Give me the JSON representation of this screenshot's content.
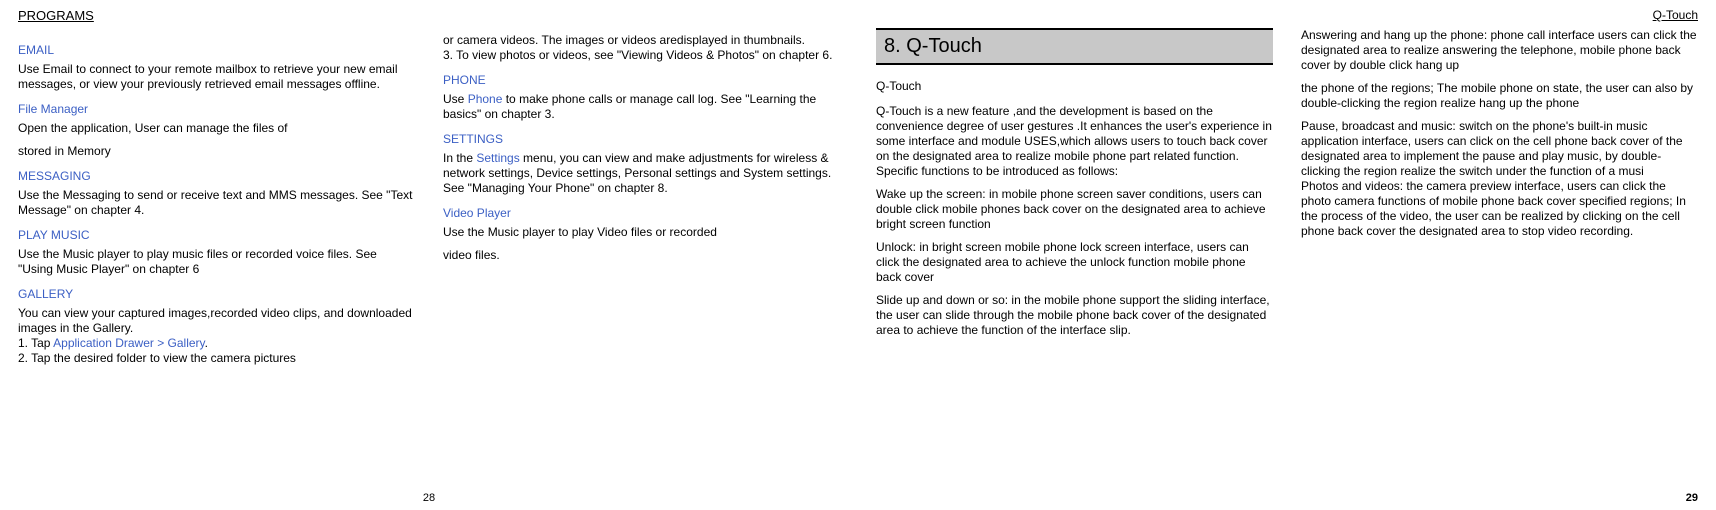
{
  "leftPage": {
    "header": "PROGRAMS",
    "col1": {
      "email_h": "EMAIL",
      "email_p": "Use Email to connect to your remote mailbox to retrieve your new email messages, or view your previously retrieved email messages offline.",
      "fm_h": "File Manager",
      "fm_p1": "Open the application, User can manage the files of",
      "fm_p2": "stored in Memory",
      "msg_h": "MESSAGING",
      "msg_p": "Use the Messaging to send or receive text and MMS messages. See \"Text Message\" on chapter 4.",
      "pm_h": "PLAY MUSIC",
      "pm_p": "Use the Music player to play music files or recorded voice files. See \"Using Music Player\" on chapter 6",
      "gal_h": "GALLERY",
      "gal_p1": "You can view your captured images,recorded video clips, and downloaded images in the Gallery.",
      "gal_p2a": "1. Tap ",
      "gal_p2b": "Application Drawer > Gallery",
      "gal_p2c": ".",
      "gal_p3": "2. Tap the desired folder to view the camera pictures"
    },
    "col2": {
      "cont1": "or camera videos. The images or videos aredisplayed in thumbnails.",
      "cont2": "3. To view photos or videos, see \"Viewing Videos & Photos\" on chapter 6.",
      "phone_h": "PHONE",
      "phone_p_a": "Use ",
      "phone_p_b": "Phone",
      "phone_p_c": " to make phone calls or manage call log. See \"Learning the basics\" on chapter 3.",
      "set_h": "SETTINGS",
      "set_p_a": "In the ",
      "set_p_b": "Settings",
      "set_p_c": " menu, you can view and make adjustments for wireless & network settings, Device settings, Personal settings and System settings. See \"Managing Your Phone\" on chapter 8.",
      "vp_h": "Video Player",
      "vp_p1": "Use the Music player to play Video files or recorded",
      "vp_p2": "video files."
    },
    "pageNum": "28"
  },
  "rightPage": {
    "header": "Q-Touch",
    "col1": {
      "banner": "8. Q-Touch",
      "sub": "Q-Touch",
      "intro": "Q-Touch is a new feature ,and the development is based on the convenience degree of user gestures .It enhances the user's experience in some interface and module USES,which allows users to touch back cover on the designated area to realize mobile phone part related function. Specific functions to be introduced as follows:",
      "wake": "Wake up the screen: in mobile phone screen saver conditions, users can double click mobile phones back cover on the designated area to achieve bright screen function",
      "unlock": "Unlock: in bright screen mobile phone lock screen interface, users can click the designated area to achieve the unlock function mobile phone back cover",
      "slide": "Slide up and down or so: in the mobile phone support the sliding interface, the user can slide through the mobile phone back cover of the designated area to achieve the function of the interface slip."
    },
    "col2": {
      "ans": "Answering and hang up the phone: phone call interface users can click the designated area to realize answering the telephone, mobile phone back cover by double click hang up",
      "reg": "the phone of the regions; The mobile phone on state, the user can also by double-clicking the region realize hang up the phone",
      "pause": "Pause, broadcast and music: switch on the phone's built-in music application interface, users can click on the cell phone back cover of the designated area to implement the pause and play music, by double-clicking the region realize the switch under the function of a musi",
      "photos": "Photos and videos: the camera preview interface, users can click the photo camera functions of mobile phone back cover specified regions; In the process of the video, the user can be realized by clicking on the cell phone back cover the designated area to stop video recording."
    },
    "pageNum": "29"
  }
}
